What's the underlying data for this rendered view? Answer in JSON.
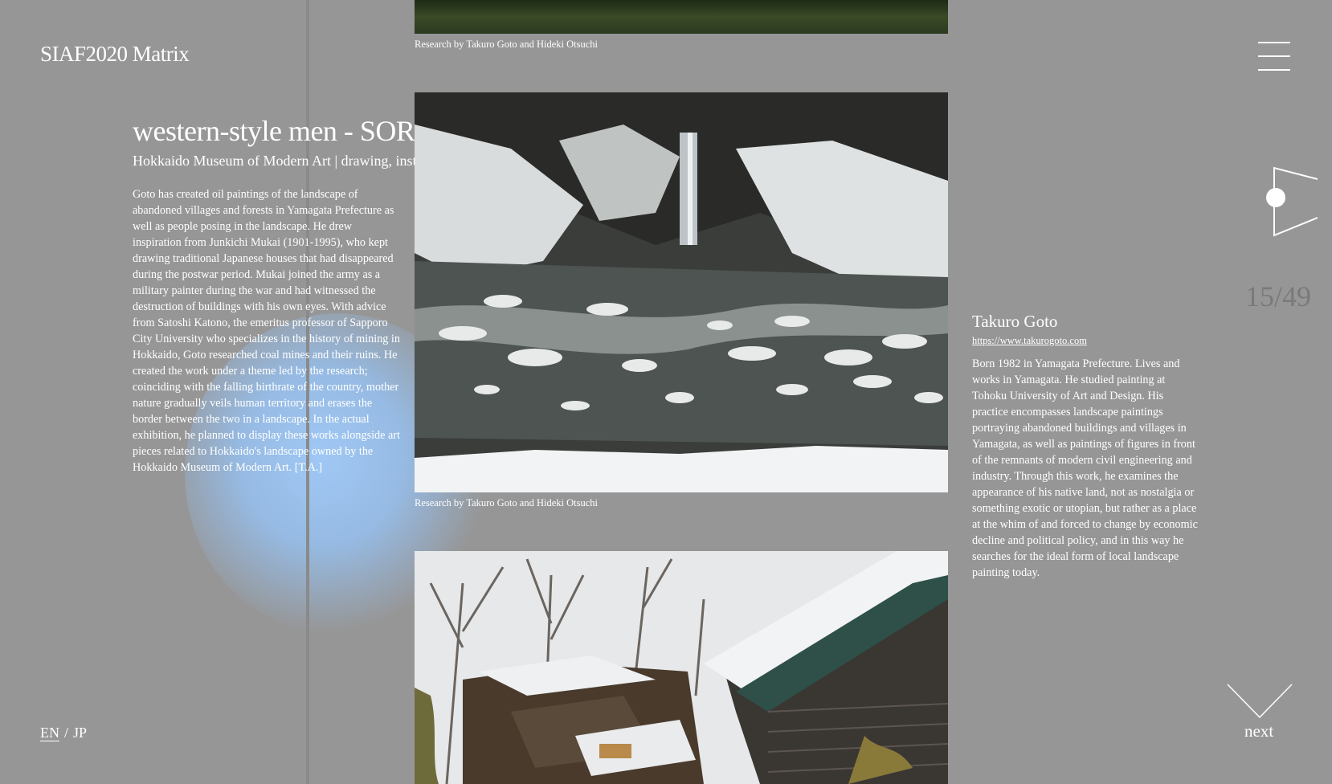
{
  "header": {
    "logo": "SIAF2020 Matrix"
  },
  "menu": {
    "icon": "hamburger-menu-icon"
  },
  "work": {
    "title": "western-style men - SORACHI",
    "subtitle": "Hokkaido Museum of Modern Art | drawing, installation",
    "description": "Goto has created oil paintings of the landscape of abandoned villages and forests in Yamagata Prefecture as well as people posing in the landscape. He drew inspiration from Junkichi Mukai (1901-1995), who kept drawing traditional Japanese houses that had disappeared during the postwar period. Mukai joined the army as a military painter during the war and had witnessed the destruction of buildings with his own eyes. With advice from Satoshi Katono, the emeritus professor of Sapporo City University who specializes in the history of mining in Hokkaido, Goto researched coal mines and their ruins. He created the work under a theme led by the research; coinciding with the falling birthrate of the country, mother nature gradually veils human territory and erases the border between the two in a landscape. In the actual exhibition, he planned to display these works alongside art pieces related to Hokkaido's landscape owned by the Hokkaido Museum of Modern Art. [T.A.]"
  },
  "photos": {
    "caption_1": "Research by Takuro Goto and Hideki Otsuchi",
    "caption_2": "Research by Takuro Goto and Hideki Otsuchi"
  },
  "artist": {
    "name": "Takuro Goto",
    "url": "https://www.takurogoto.com",
    "bio": "Born 1982 in Yamagata Prefecture. Lives and works in Yamagata. He studied painting at Tohoku University of Art and Design. His practice encompasses landscape paintings portraying abandoned buildings and villages in Yamagata, as well as paintings of figures in front of the remnants of modern civil engineering and industry. Through this work, he examines the appearance of his native land, not as nostalgia or something exotic or utopian, but rather as a place at the whim of and forced to change by economic decline and political policy, and in this way he searches for the ideal form of local landscape painting today."
  },
  "navigation": {
    "counter": "15/49",
    "next_label": "next"
  },
  "language": {
    "en": "EN",
    "separator": "/",
    "jp": "JP"
  },
  "colors": {
    "background": "#969696",
    "glow": "#a6c8f0",
    "counter": "#7a7a7a"
  }
}
